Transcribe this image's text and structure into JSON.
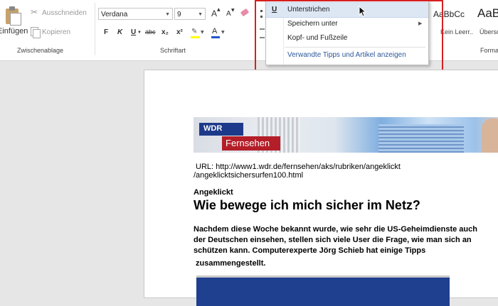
{
  "clipboard": {
    "paste_label": "Einfügen",
    "cut_label": "Ausschneiden",
    "copy_label": "Kopieren",
    "group_label": "Zwischenablage"
  },
  "font": {
    "family": "Verdana",
    "size": "9",
    "bold": "F",
    "italic": "K",
    "underline": "U",
    "strike": "abc",
    "subscript": "x₂",
    "superscript": "x²",
    "grow": "A",
    "shrink": "A",
    "font_color": "A",
    "group_label": "Schriftart"
  },
  "context_menu": {
    "items": [
      {
        "icon": "U",
        "label": "Unterstrichen"
      },
      {
        "label": "Speichern unter"
      },
      {
        "label": "Kopf- und Fußzeile"
      },
      {
        "label": "Verwandte Tipps und Artikel anzeigen"
      }
    ]
  },
  "styles": {
    "style1_preview": "AaBbCc",
    "style1_name": "Kein Leerr...",
    "style2_preview": "AaB",
    "style2_name": "Übersc",
    "group_label": "Forma"
  },
  "document": {
    "banner_logo": "WDR",
    "banner_title": "Fernsehen",
    "url_line1": "URL: http://www1.wdr.de/fernsehen/aks/rubriken/angeklickt",
    "url_line2": "/angeklicktsichersurfen100.html",
    "kicker": "Angeklickt",
    "headline": "Wie bewege ich mich sicher im Netz?",
    "body_lines": [
      "Nachdem diese Woche bekannt wurde, wie sehr die US-Geheimdienste auch",
      "der Deutschen einsehen, stellen sich viele User die Frage, wie man sich an",
      "schützen kann. Computerexperte Jörg Schieb hat einige Tipps",
      "zusammengestellt."
    ]
  },
  "colors": {
    "accent_blue": "#2b579a",
    "highlight_red": "#d62020",
    "wdr_red": "#b41e28",
    "wdr_blue": "#1d3a8a"
  }
}
